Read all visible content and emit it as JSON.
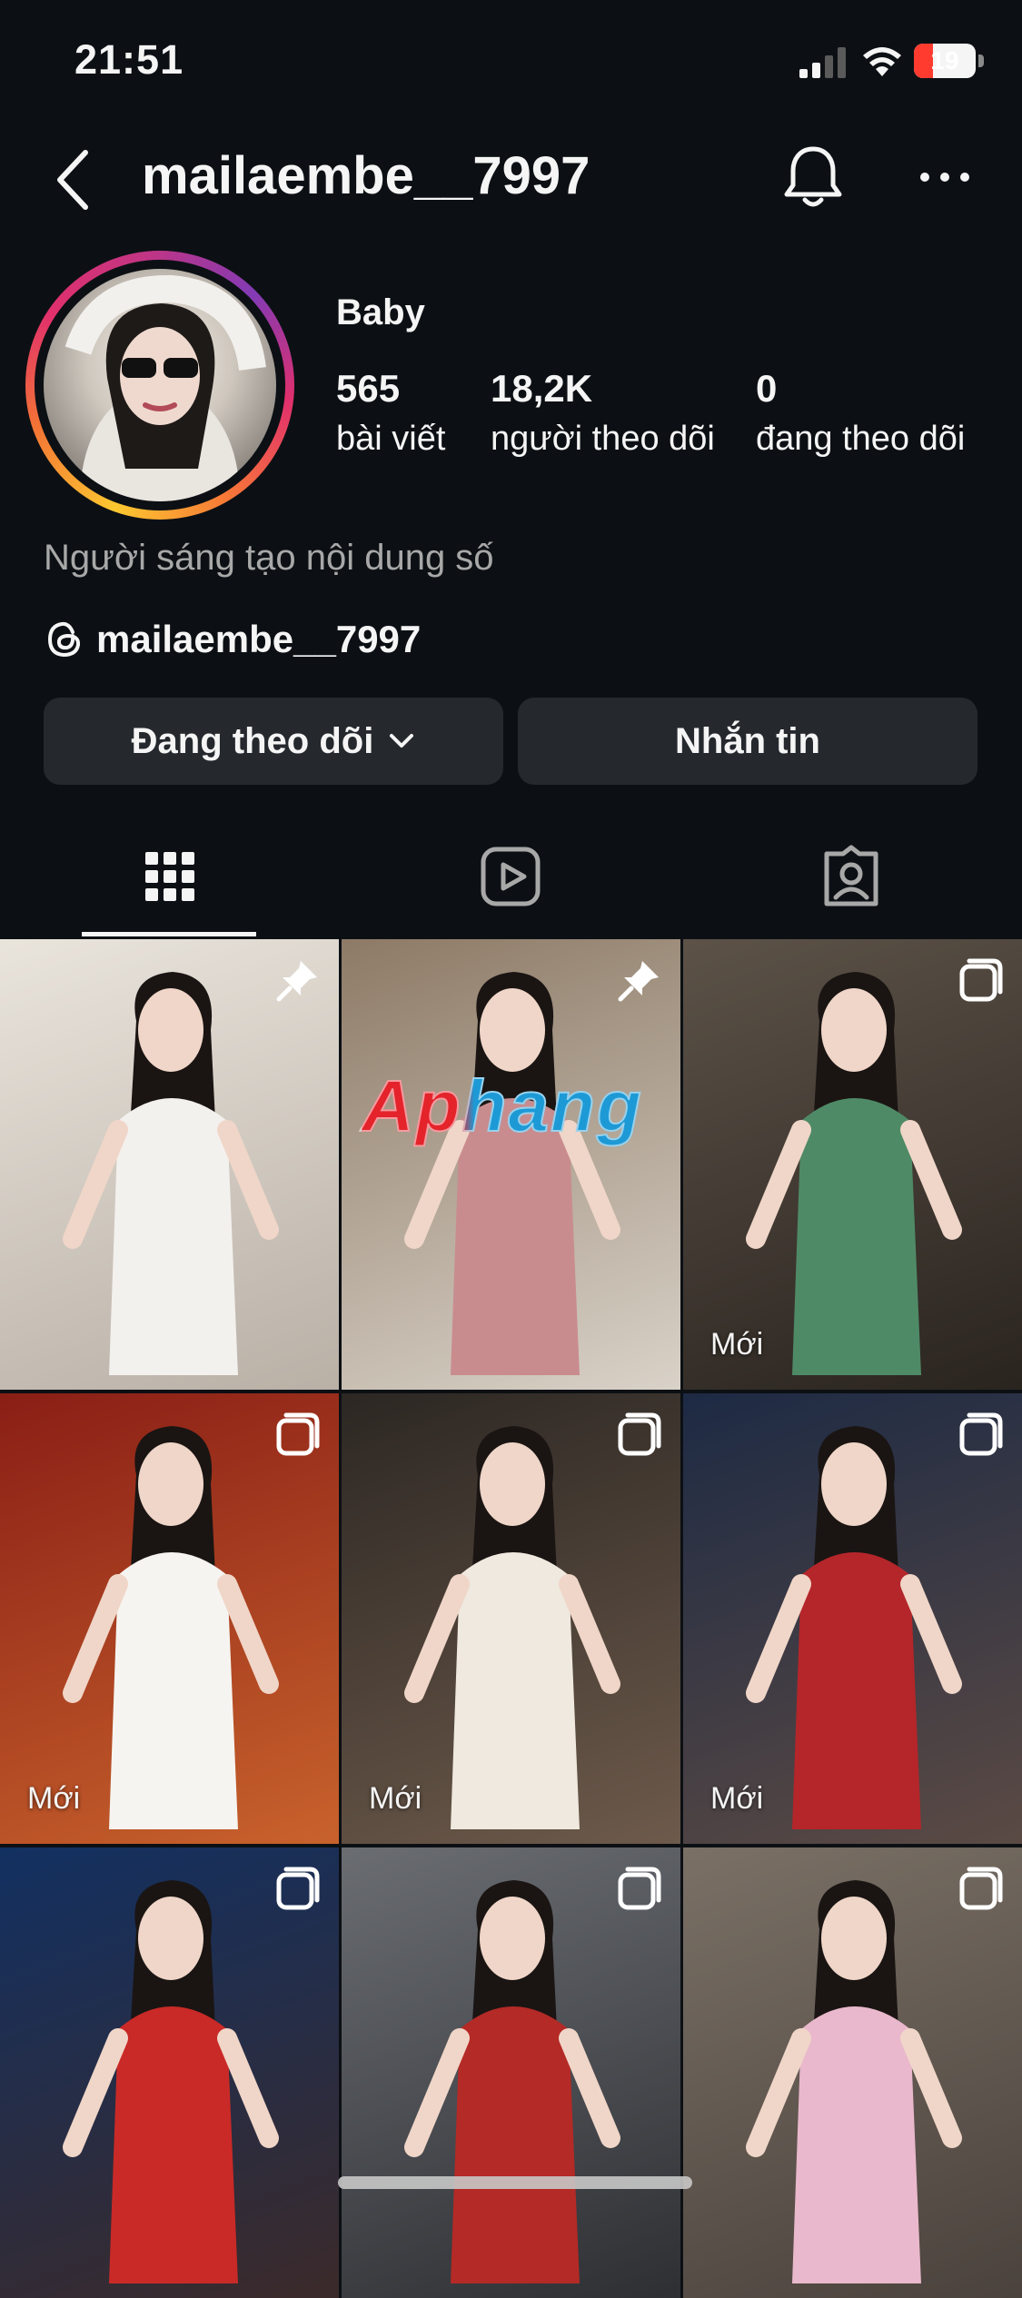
{
  "status_bar": {
    "time": "21:51",
    "battery": "19",
    "battery_level": 0.19
  },
  "header": {
    "username": "mailaembe__7997"
  },
  "profile": {
    "display_name": "Baby",
    "stats": [
      {
        "value": "565",
        "label": "bài viết"
      },
      {
        "value": "18,2K",
        "label": "người theo dõi"
      },
      {
        "value": "0",
        "label": "đang theo dõi"
      }
    ],
    "category": "Người sáng tạo nội dung số",
    "threads_handle": "mailaembe__7997"
  },
  "actions": {
    "following_label": "Đang theo dõi",
    "message_label": "Nhắn tin"
  },
  "tabs": [
    {
      "icon": "grid-icon",
      "selected": true
    },
    {
      "icon": "reels-icon",
      "selected": false
    },
    {
      "icon": "tagged-icon",
      "selected": false
    }
  ],
  "watermark": "Aphang",
  "posts": [
    {
      "badge": "pin-icon",
      "new_label": "",
      "bg": [
        "#e9e4dc",
        "#b9b0a6"
      ],
      "outfit": "#f3f1ee"
    },
    {
      "badge": "pin-icon",
      "new_label": "",
      "bg": [
        "#8d7a66",
        "#d9d2c8"
      ],
      "outfit": "#c98c8e"
    },
    {
      "badge": "carousel-icon",
      "new_label": "Mới",
      "bg": [
        "#5c5248",
        "#2a241f"
      ],
      "outfit": "#4f8a66"
    },
    {
      "badge": "carousel-icon",
      "new_label": "Mới",
      "bg": [
        "#8a1e16",
        "#c8622c"
      ],
      "outfit": "#f6f4f0"
    },
    {
      "badge": "carousel-icon",
      "new_label": "Mới",
      "bg": [
        "#2c2723",
        "#6d5a4b"
      ],
      "outfit": "#efe9df"
    },
    {
      "badge": "carousel-icon",
      "new_label": "Mới",
      "bg": [
        "#1d2a44",
        "#5b4a44"
      ],
      "outfit": "#b4262a"
    },
    {
      "badge": "carousel-icon",
      "new_label": "",
      "bg": [
        "#123061",
        "#3b2a2a"
      ],
      "outfit": "#c92a27"
    },
    {
      "badge": "carousel-icon",
      "new_label": "",
      "bg": [
        "#6a6d72",
        "#2d2f33"
      ],
      "outfit": "#b42a26"
    },
    {
      "badge": "carousel-icon",
      "new_label": "",
      "bg": [
        "#7a7066",
        "#4a423c"
      ],
      "outfit": "#e9b8cc"
    }
  ],
  "colors": {
    "background": "#0c1014",
    "button": "#25292e",
    "muted_text": "#a8a8a8"
  }
}
